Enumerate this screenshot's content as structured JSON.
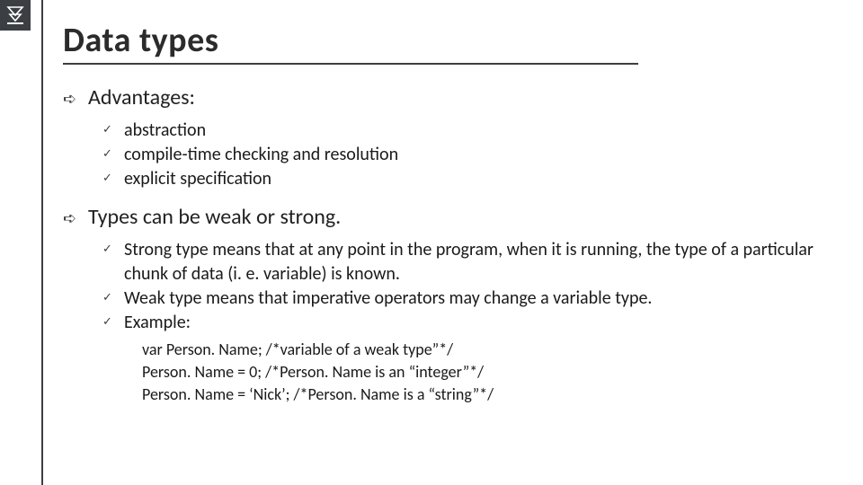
{
  "title": "Data types",
  "sections": {
    "0": {
      "heading": "Advantages:",
      "items": {
        "0": "abstraction",
        "1": "compile-time checking and resolution",
        "2": "explicit specification"
      }
    },
    "1": {
      "heading": "Types can be weak or strong.",
      "items": {
        "0": "Strong type means that at any point in the program, when it is running, the type of a particular chunk of data (i. e. variable) is known.",
        "1": "Weak type means that imperative operators may change a variable type.",
        "2": "Example:"
      },
      "code": {
        "0": "var Person. Name; /*variable of a weak type”*/",
        "1": "Person. Name = 0; /*Person. Name is an “integer”*/",
        "2": "Person. Name = ‘Nick’; /*Person. Name is a “string”*/"
      }
    }
  }
}
